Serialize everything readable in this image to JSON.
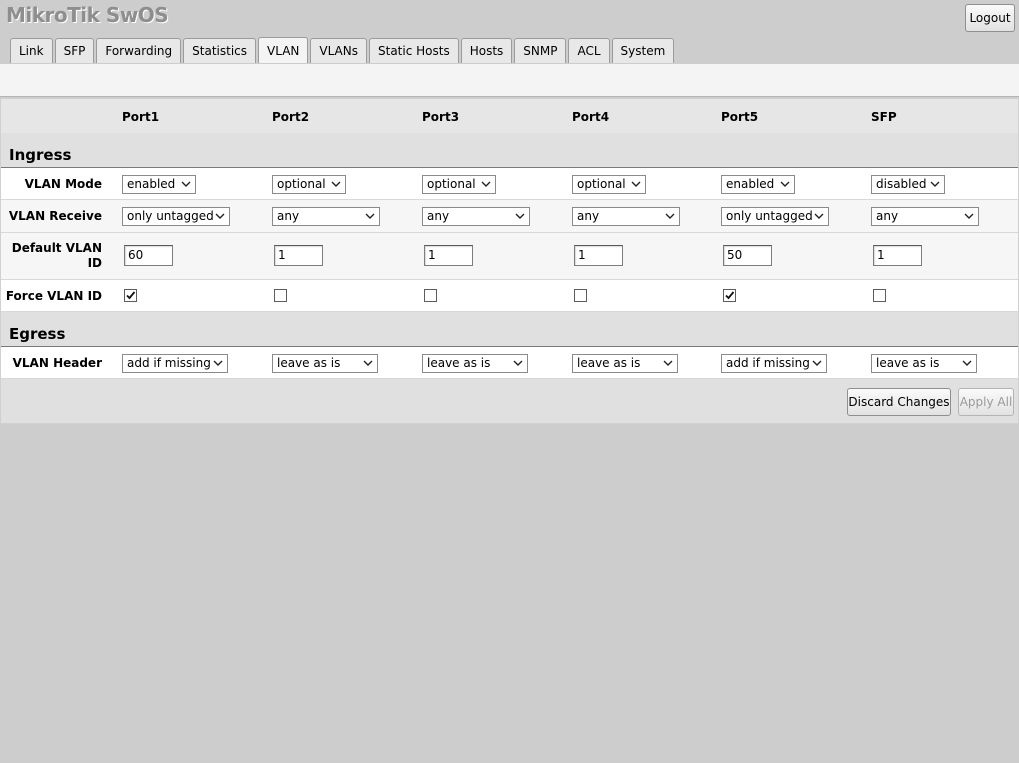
{
  "app": {
    "title": "MikroTik SwOS",
    "logout_label": "Logout"
  },
  "tabs": [
    {
      "label": "Link"
    },
    {
      "label": "SFP"
    },
    {
      "label": "Forwarding"
    },
    {
      "label": "Statistics"
    },
    {
      "label": "VLAN",
      "active": true
    },
    {
      "label": "VLANs"
    },
    {
      "label": "Static Hosts"
    },
    {
      "label": "Hosts"
    },
    {
      "label": "SNMP"
    },
    {
      "label": "ACL"
    },
    {
      "label": "System"
    }
  ],
  "ports": [
    "Port1",
    "Port2",
    "Port3",
    "Port4",
    "Port5",
    "SFP"
  ],
  "ingress": {
    "title": "Ingress",
    "vlan_mode": {
      "label": "VLAN Mode",
      "values": [
        "enabled",
        "optional",
        "optional",
        "optional",
        "enabled",
        "disabled"
      ]
    },
    "vlan_receive": {
      "label": "VLAN Receive",
      "values": [
        "only untagged",
        "any",
        "any",
        "any",
        "only untagged",
        "any"
      ]
    },
    "default_vlan_id": {
      "label_line1": "Default VLAN",
      "label_line2": "ID",
      "values": [
        "60",
        "1",
        "1",
        "1",
        "50",
        "1"
      ]
    },
    "force_vlan_id": {
      "label": "Force VLAN ID",
      "values": [
        true,
        false,
        false,
        false,
        true,
        false
      ]
    }
  },
  "egress": {
    "title": "Egress",
    "vlan_header": {
      "label": "VLAN Header",
      "values": [
        "add if missing",
        "leave as is",
        "leave as is",
        "leave as is",
        "add if missing",
        "leave as is"
      ]
    }
  },
  "actions": {
    "discard_label": "Discard Changes",
    "apply_label": "Apply All",
    "apply_enabled": false
  },
  "colors": {
    "background": "#cdcdcd",
    "panel": "#e0e0e0",
    "row": "#ffffff",
    "brand_text": "#8e8e8e"
  },
  "icons": {
    "dropdown": "chevron-down-icon",
    "checkbox_mark": "check-icon"
  }
}
